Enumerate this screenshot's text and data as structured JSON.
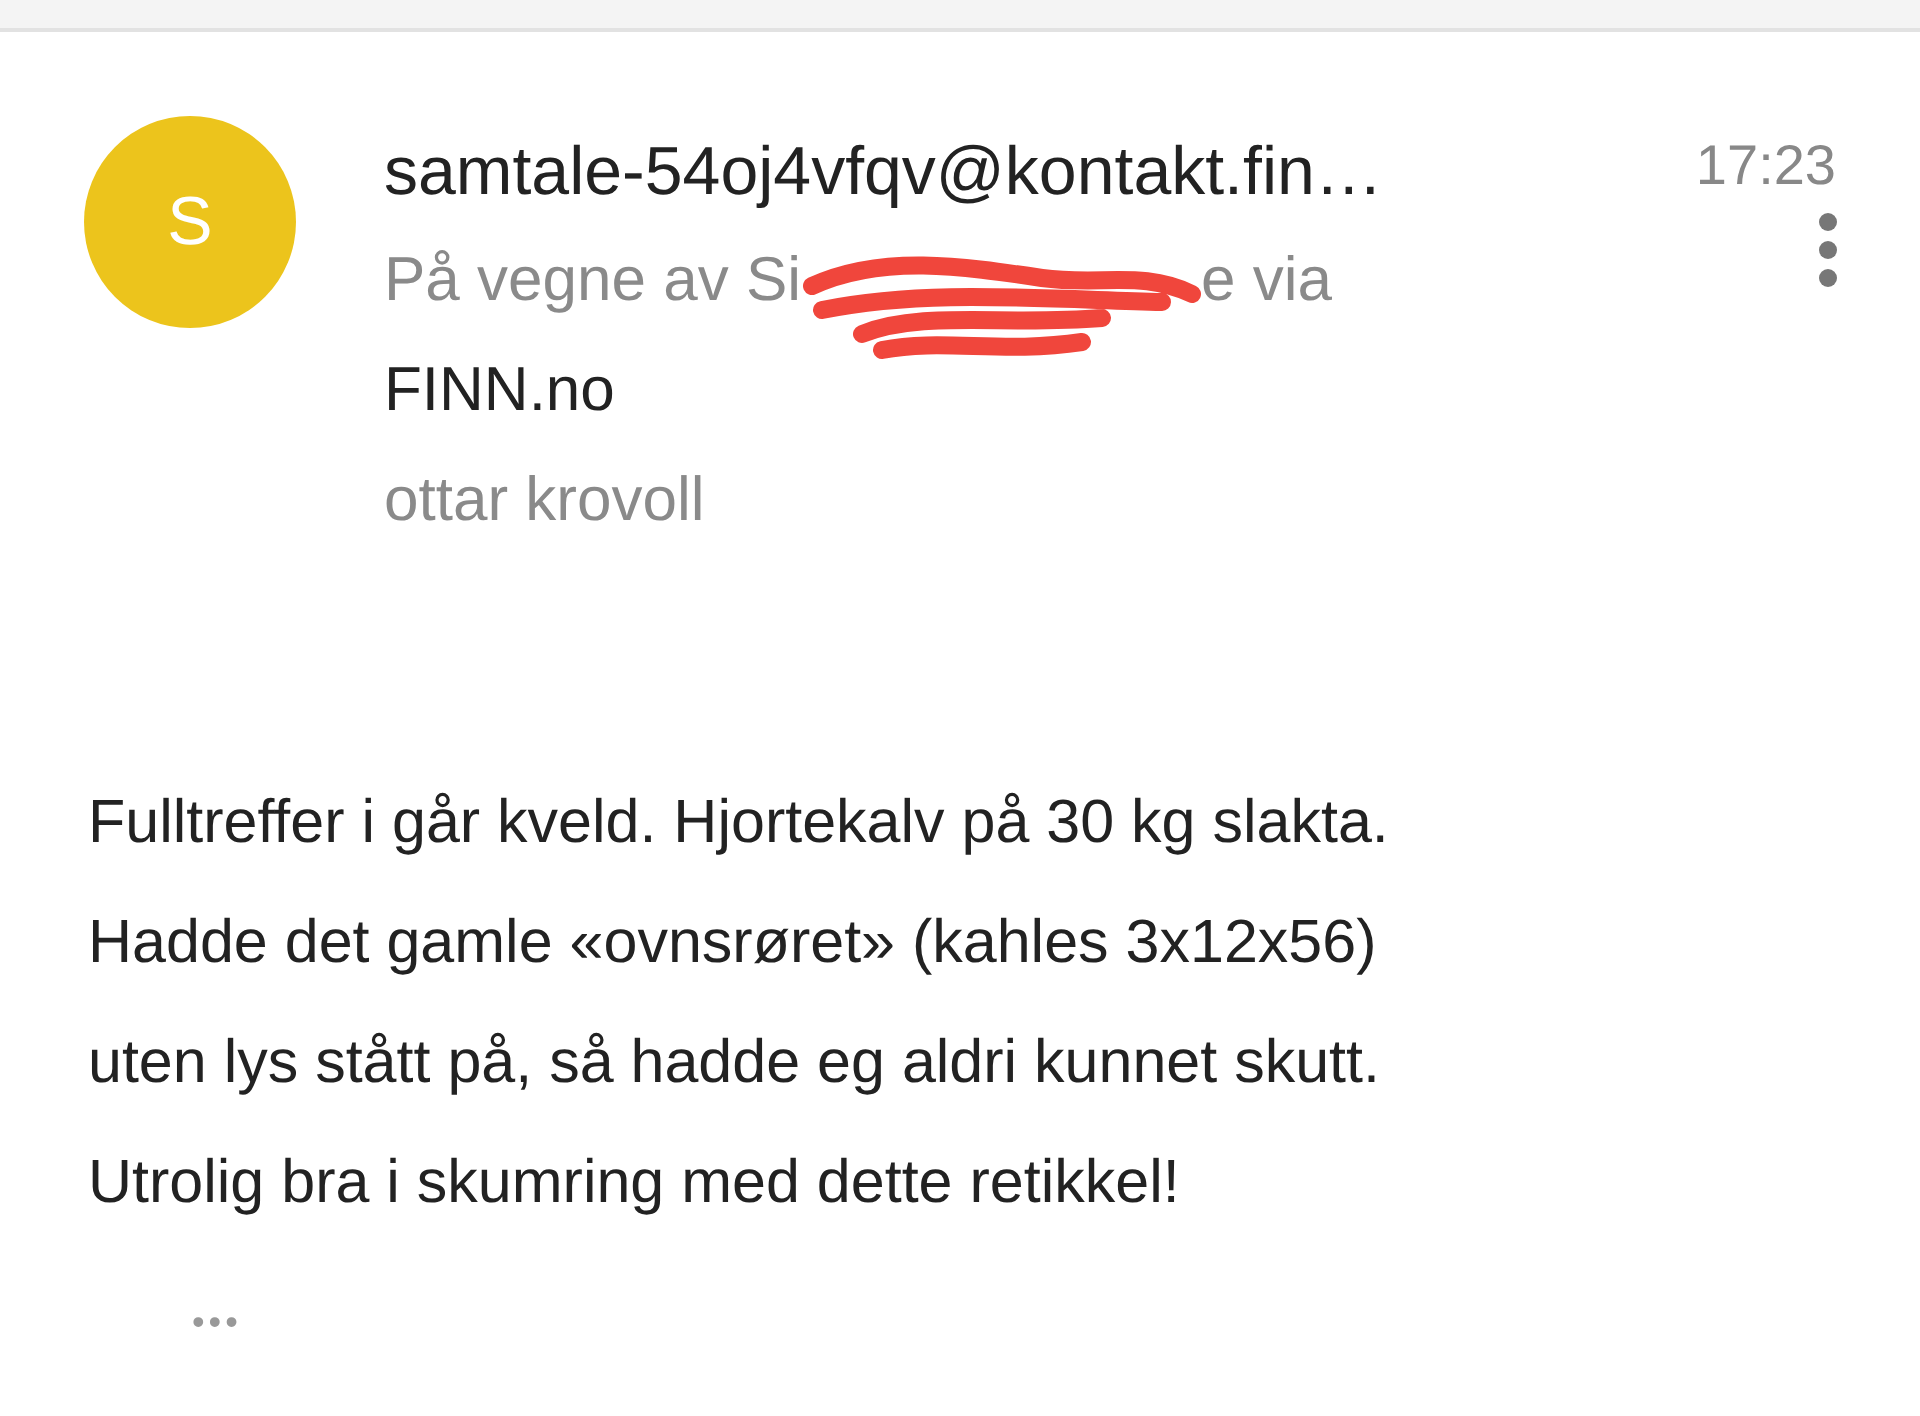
{
  "message": {
    "avatar_letter": "S",
    "sender": "samtale-54oj4vfqv@kontakt.fin…",
    "time": "17:23",
    "on_behalf_start": "På vegne av Si",
    "on_behalf_end": "e via",
    "on_behalf_redacted": true,
    "service": "FINN.no",
    "recipient": "ottar krovoll",
    "body": [
      "Fulltreffer i går kveld. Hjortekalv på 30 kg slakta.",
      "Hadde det gamle «ovnsrøret» (kahles 3x12x56)",
      "uten lys stått på, så hadde eg aldri kunnet skutt.",
      "Utrolig bra i skumring med dette retikkel!"
    ],
    "more": "•••"
  }
}
